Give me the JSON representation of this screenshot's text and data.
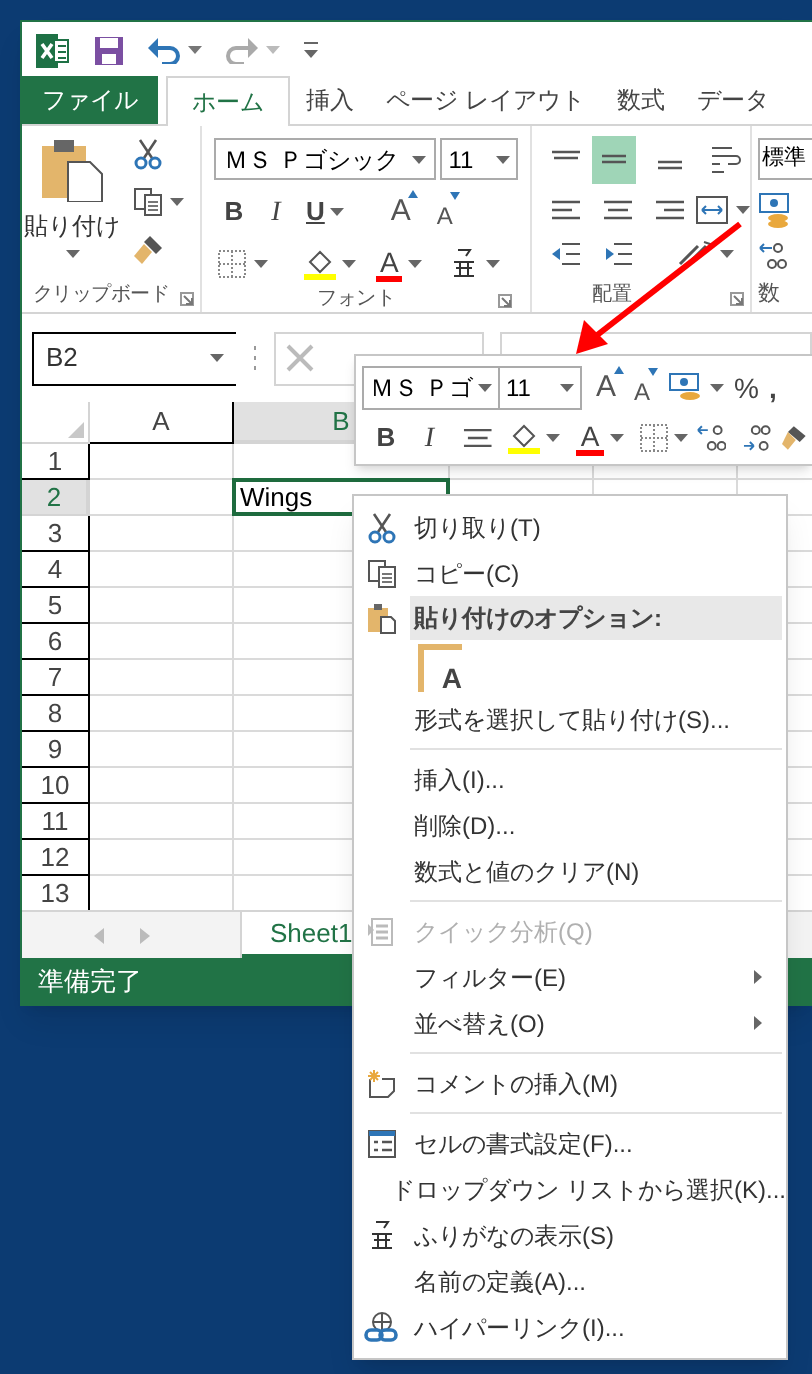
{
  "ribbon_tabs": [
    {
      "label": "ファイル",
      "kind": "file",
      "selected": false
    },
    {
      "label": "ホーム",
      "kind": "tab",
      "selected": true
    },
    {
      "label": "挿入",
      "kind": "tab",
      "selected": false
    },
    {
      "label": "ページ レイアウト",
      "kind": "tab",
      "selected": false
    },
    {
      "label": "数式",
      "kind": "tab",
      "selected": false
    },
    {
      "label": "データ",
      "kind": "tab",
      "selected": false
    }
  ],
  "ribbon": {
    "paste_label": "貼り付け",
    "font_name": "ＭＳ Ｐゴシック",
    "font_size": "11",
    "bold": "B",
    "italic": "I",
    "underline": "U",
    "grow_font": "A",
    "shrink_font": "A",
    "font_color": "A",
    "number_format": "標準",
    "groups": [
      "クリップボード",
      "フォント",
      "配置",
      "数"
    ]
  },
  "name_box": "B2",
  "columns": [
    {
      "label": "A",
      "selected": false
    },
    {
      "label": "B",
      "selected": true
    }
  ],
  "rows": [
    {
      "label": "1",
      "selected": false
    },
    {
      "label": "2",
      "selected": true
    },
    {
      "label": "3",
      "selected": false
    },
    {
      "label": "4",
      "selected": false
    },
    {
      "label": "5",
      "selected": false
    },
    {
      "label": "6",
      "selected": false
    },
    {
      "label": "7",
      "selected": false
    },
    {
      "label": "8",
      "selected": false
    },
    {
      "label": "9",
      "selected": false
    },
    {
      "label": "10",
      "selected": false
    },
    {
      "label": "11",
      "selected": false
    },
    {
      "label": "12",
      "selected": false
    },
    {
      "label": "13",
      "selected": false
    }
  ],
  "active_cell": {
    "text": "Wings"
  },
  "sheet_tabs": [
    {
      "label": "Sheet1",
      "selected": true
    }
  ],
  "status_bar": {
    "text": "準備完了"
  },
  "mini_toolbar": {
    "font_name": "ＭＳ Ｐゴ",
    "font_size": "11",
    "grow_font": "A",
    "shrink_font": "A",
    "percent": "%",
    "comma": ",",
    "bold": "B",
    "italic": "I",
    "font_color": "A"
  },
  "context_menu": {
    "items": [
      {
        "kind": "item",
        "label": "切り取り(T)",
        "disabled": false,
        "submenu": false
      },
      {
        "kind": "item",
        "label": "コピー(C)",
        "disabled": false,
        "submenu": false
      },
      {
        "kind": "header",
        "label": "貼り付けのオプション:"
      },
      {
        "kind": "paste_options",
        "glyph": "A"
      },
      {
        "kind": "item",
        "label": "形式を選択して貼り付け(S)...",
        "disabled": false,
        "submenu": false
      },
      {
        "kind": "separator"
      },
      {
        "kind": "item",
        "label": "挿入(I)...",
        "disabled": false,
        "submenu": false
      },
      {
        "kind": "item",
        "label": "削除(D)...",
        "disabled": false,
        "submenu": false
      },
      {
        "kind": "item",
        "label": "数式と値のクリア(N)",
        "disabled": false,
        "submenu": false
      },
      {
        "kind": "separator"
      },
      {
        "kind": "item",
        "label": "クイック分析(Q)",
        "disabled": true,
        "submenu": false
      },
      {
        "kind": "item",
        "label": "フィルター(E)",
        "disabled": false,
        "submenu": true
      },
      {
        "kind": "item",
        "label": "並べ替え(O)",
        "disabled": false,
        "submenu": true
      },
      {
        "kind": "separator"
      },
      {
        "kind": "item",
        "label": "コメントの挿入(M)",
        "disabled": false,
        "submenu": false
      },
      {
        "kind": "separator"
      },
      {
        "kind": "item",
        "label": "セルの書式設定(F)...",
        "disabled": false,
        "submenu": false
      },
      {
        "kind": "item",
        "label": "ドロップダウン リストから選択(K)...",
        "disabled": false,
        "submenu": false
      },
      {
        "kind": "item",
        "label": "ふりがなの表示(S)",
        "disabled": false,
        "submenu": false
      },
      {
        "kind": "item",
        "label": "名前の定義(A)...",
        "disabled": false,
        "submenu": false
      },
      {
        "kind": "item",
        "label": "ハイパーリンク(I)...",
        "disabled": false,
        "submenu": false
      }
    ]
  }
}
